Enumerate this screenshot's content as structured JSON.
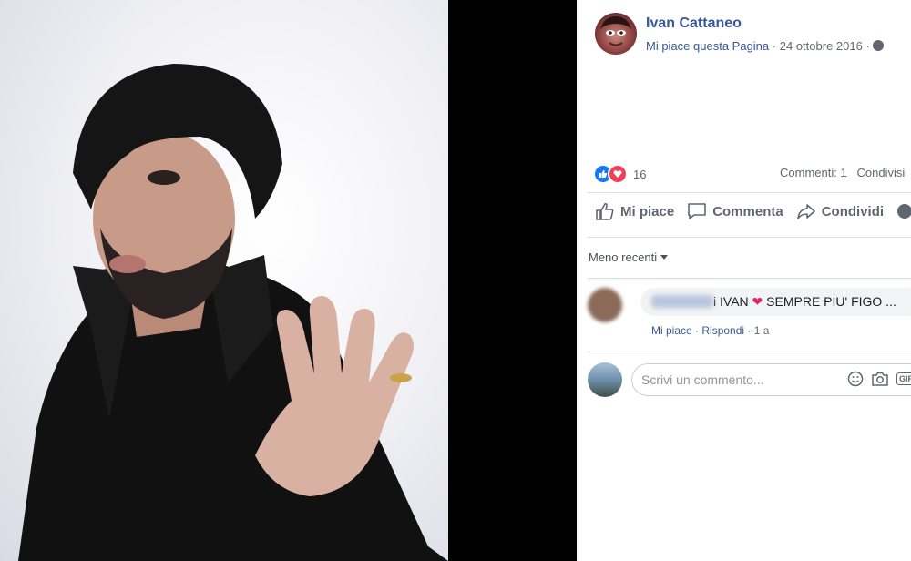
{
  "post": {
    "author": "Ivan Cattaneo",
    "page_action": "Mi piace questa Pagina",
    "date": "24 ottobre 2016",
    "separator": "·",
    "privacy_icon": "globe-icon"
  },
  "reactions": {
    "count": "16",
    "types": [
      "like-icon",
      "love-icon"
    ],
    "comments_label": "Commenti: 1",
    "shares_label": "Condivisi"
  },
  "actions": {
    "like": "Mi piace",
    "comment": "Commenta",
    "share": "Condividi"
  },
  "comments_sort": {
    "label": "Meno recenti"
  },
  "comment": {
    "text_before": "i IVAN",
    "text_after": "SEMPRE PIU' FIGO ...",
    "like": "Mi piace",
    "reply": "Rispondi",
    "time": "1 a"
  },
  "composer": {
    "placeholder": "Scrivi un commento...",
    "gif_label": "GIF"
  },
  "colors": {
    "link": "#385898",
    "like_blue": "#1877f2",
    "love_red": "#f33e58",
    "muted": "#616770"
  }
}
